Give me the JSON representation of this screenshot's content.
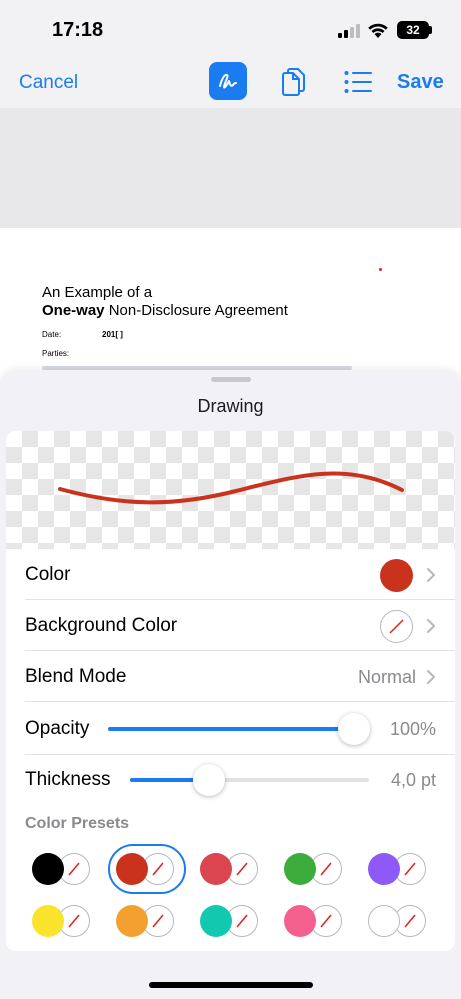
{
  "status_bar": {
    "time": "17:18",
    "battery": "32",
    "signal_bars_on": 2,
    "signal_bars_total": 4
  },
  "toolbar": {
    "cancel": "Cancel",
    "save": "Save",
    "draw_icon": "signature-pen-icon",
    "pages_icon": "documents-icon",
    "list_icon": "list-icon"
  },
  "document": {
    "title_line1": "An Example of a",
    "title_bold": "One-way",
    "title_rest": " Non-Disclosure Agreement",
    "date_label": "Date:",
    "date_value": "201[ ]",
    "parties_label": "Parties:"
  },
  "sheet": {
    "title": "Drawing",
    "stroke_color": "#c9331e",
    "rows": {
      "color": {
        "label": "Color",
        "value_color": "#c9331e"
      },
      "background_color": {
        "label": "Background Color",
        "value": "none"
      },
      "blend_mode": {
        "label": "Blend Mode",
        "value": "Normal"
      },
      "opacity": {
        "label": "Opacity",
        "value": "100%",
        "level": 1.0
      },
      "thickness": {
        "label": "Thickness",
        "value": "4,0 pt",
        "level": 0.33
      }
    },
    "presets_label": "Color Presets",
    "presets": [
      {
        "name": "black",
        "color": "#000000",
        "selected": false
      },
      {
        "name": "red",
        "color": "#c9331e",
        "selected": true
      },
      {
        "name": "light-red",
        "color": "#db4550",
        "selected": false
      },
      {
        "name": "green",
        "color": "#3cad3c",
        "selected": false
      },
      {
        "name": "purple",
        "color": "#8e5af7",
        "selected": false
      },
      {
        "name": "yellow",
        "color": "#f9e32c",
        "selected": false
      },
      {
        "name": "orange",
        "color": "#f4a030",
        "selected": false
      },
      {
        "name": "teal",
        "color": "#12c9b0",
        "selected": false
      },
      {
        "name": "pink",
        "color": "#f3608e",
        "selected": false
      },
      {
        "name": "white",
        "color": "#ffffff",
        "selected": false
      }
    ]
  }
}
